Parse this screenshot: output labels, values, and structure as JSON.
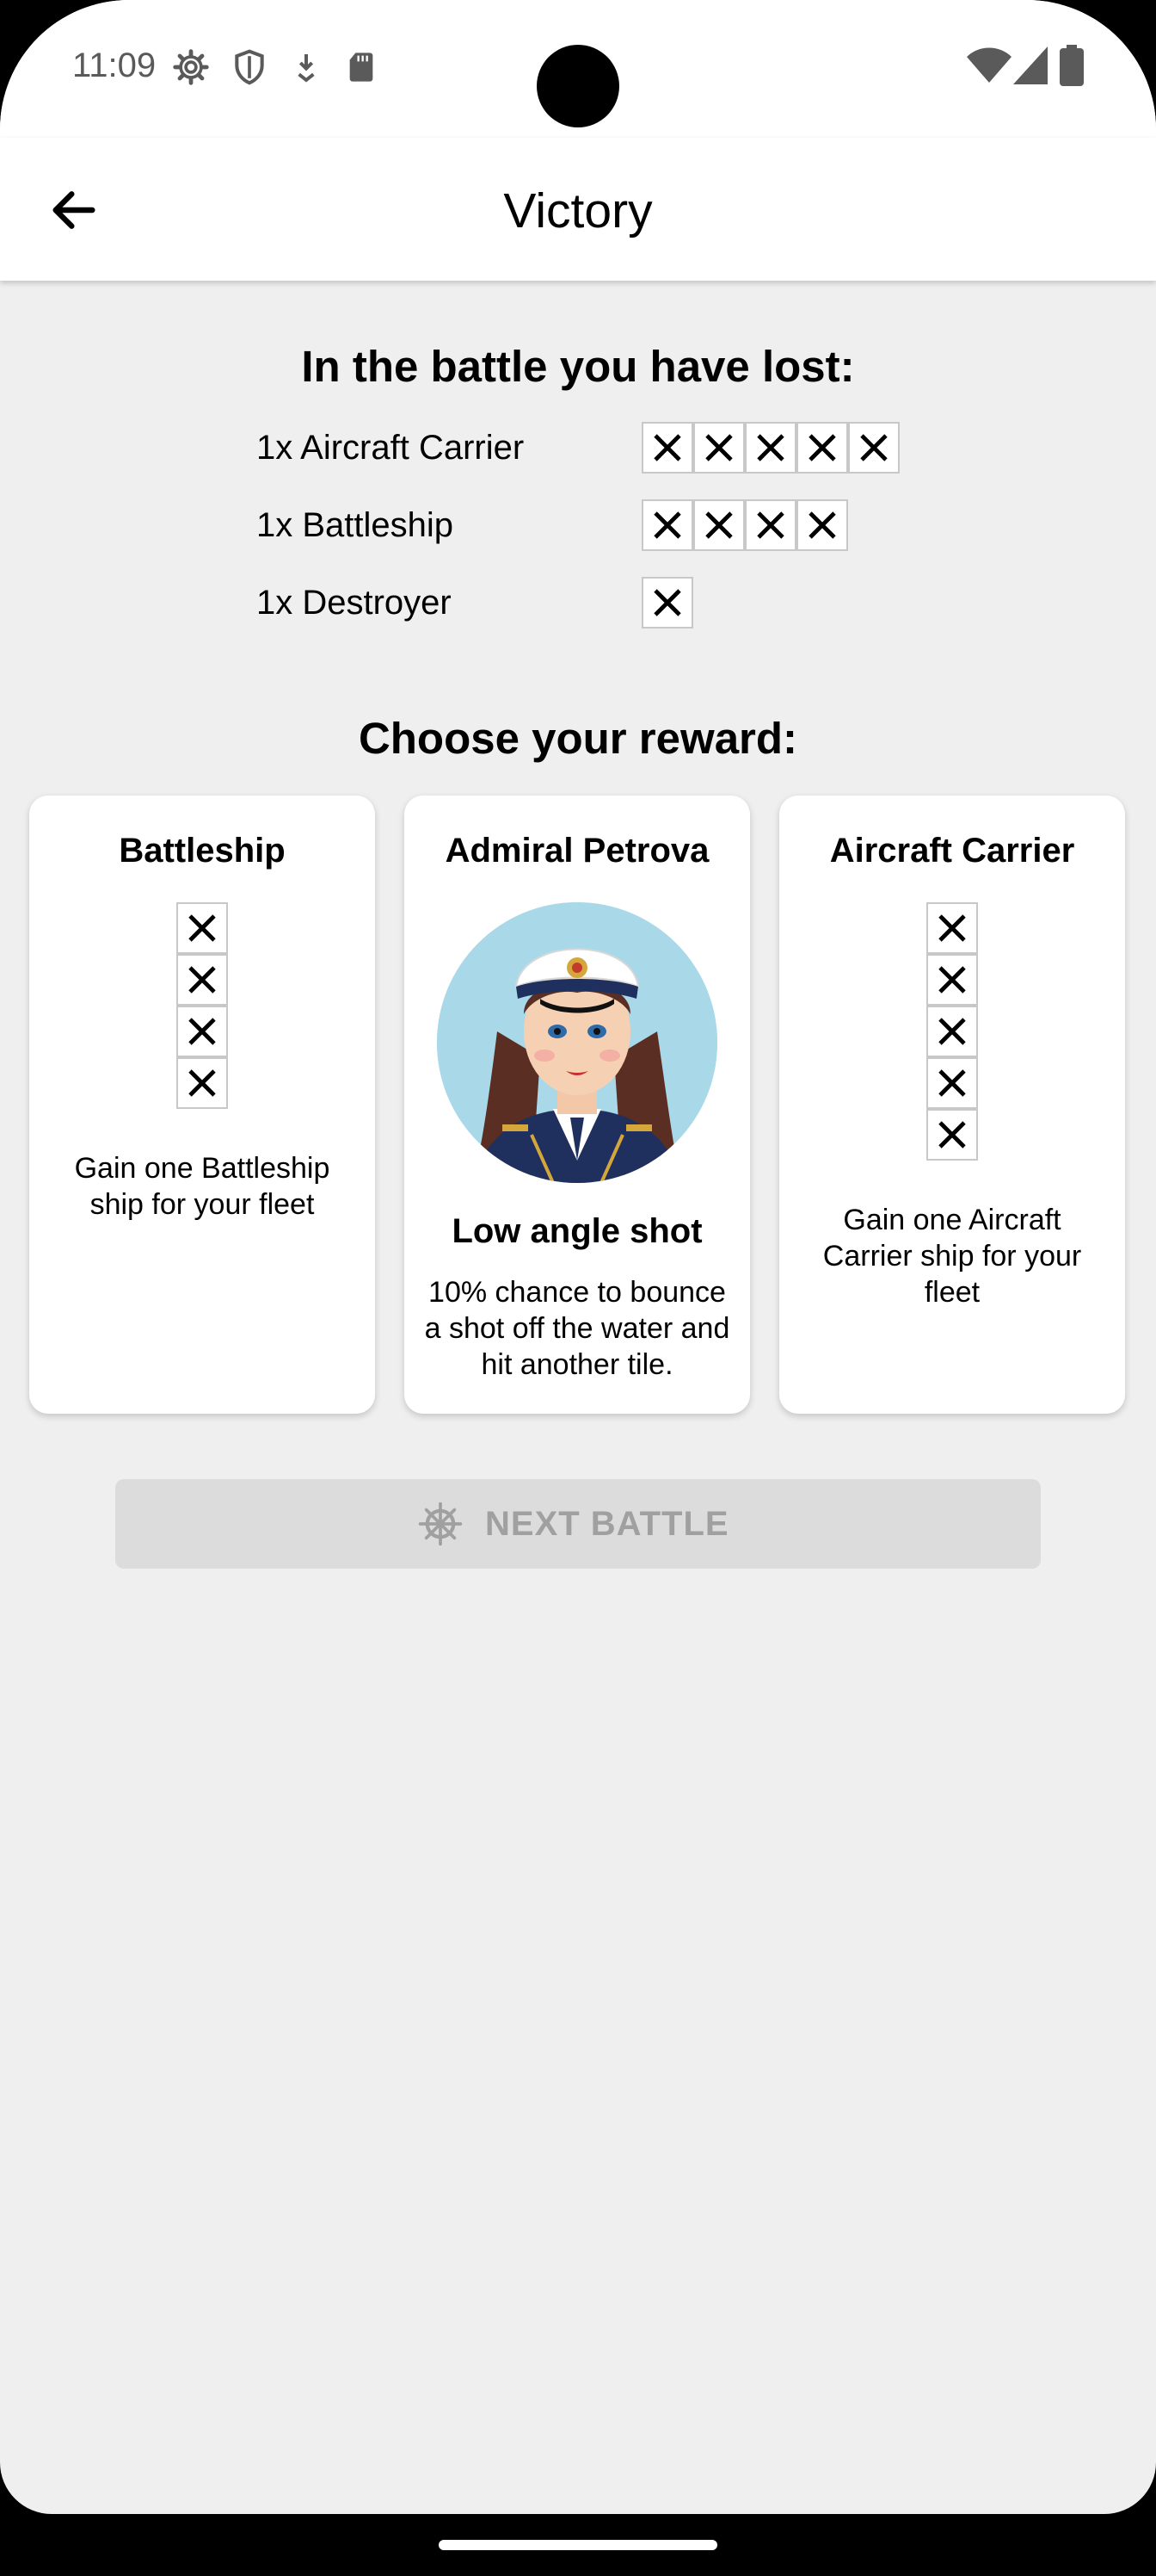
{
  "status_bar": {
    "time": "11:09",
    "icons": [
      "settings-icon",
      "shield-icon",
      "download-icon",
      "sd-card-icon",
      "wifi-icon",
      "signal-icon",
      "battery-icon"
    ]
  },
  "app_bar": {
    "back_icon": "arrow-left-icon",
    "title": "Victory"
  },
  "losses": {
    "heading": "In the battle you have lost:",
    "items": [
      {
        "label": "1x Aircraft Carrier",
        "cells": 5
      },
      {
        "label": "1x Battleship",
        "cells": 4
      },
      {
        "label": "1x Destroyer",
        "cells": 1
      }
    ]
  },
  "rewards": {
    "heading": "Choose your reward:",
    "cards": [
      {
        "title": "Battleship",
        "cells": 4,
        "description": "Gain one Battleship ship for your fleet"
      },
      {
        "title": "Admiral Petrova",
        "skill": "Low angle shot",
        "description": "10% chance to bounce a shot off the water and hit another tile."
      },
      {
        "title": "Aircraft Carrier",
        "cells": 5,
        "description": "Gain one Aircraft Carrier ship for your fleet"
      }
    ]
  },
  "next_button": {
    "label": "NEXT BATTLE",
    "icon": "ship-wheel-icon"
  },
  "colors": {
    "background": "#efefef",
    "surface": "#ffffff",
    "disabled_button": "#dcdcdc",
    "disabled_text": "#a0a0a0"
  }
}
